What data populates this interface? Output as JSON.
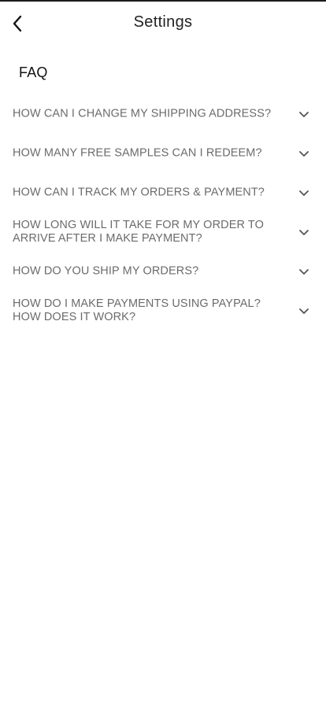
{
  "header": {
    "title": "Settings"
  },
  "section": {
    "title": "FAQ"
  },
  "faq": [
    {
      "question": "HOW CAN I CHANGE MY SHIPPING ADDRESS?"
    },
    {
      "question": "HOW MANY FREE SAMPLES CAN I REDEEM?"
    },
    {
      "question": "HOW CAN I TRACK MY ORDERS & PAYMENT?"
    },
    {
      "question": "HOW LONG WILL IT TAKE FOR MY ORDER TO ARRIVE AFTER I MAKE PAYMENT?"
    },
    {
      "question": "HOW DO YOU SHIP MY ORDERS?"
    },
    {
      "question": "HOW DO I MAKE PAYMENTS USING PAYPAL? HOW DOES IT WORK?"
    }
  ],
  "icons": {
    "back": "chevron-left-icon",
    "expand": "chevron-down-icon"
  },
  "colors": {
    "text_primary": "#222222",
    "text_question": "#6b6b6b",
    "chevron": "#555555"
  }
}
